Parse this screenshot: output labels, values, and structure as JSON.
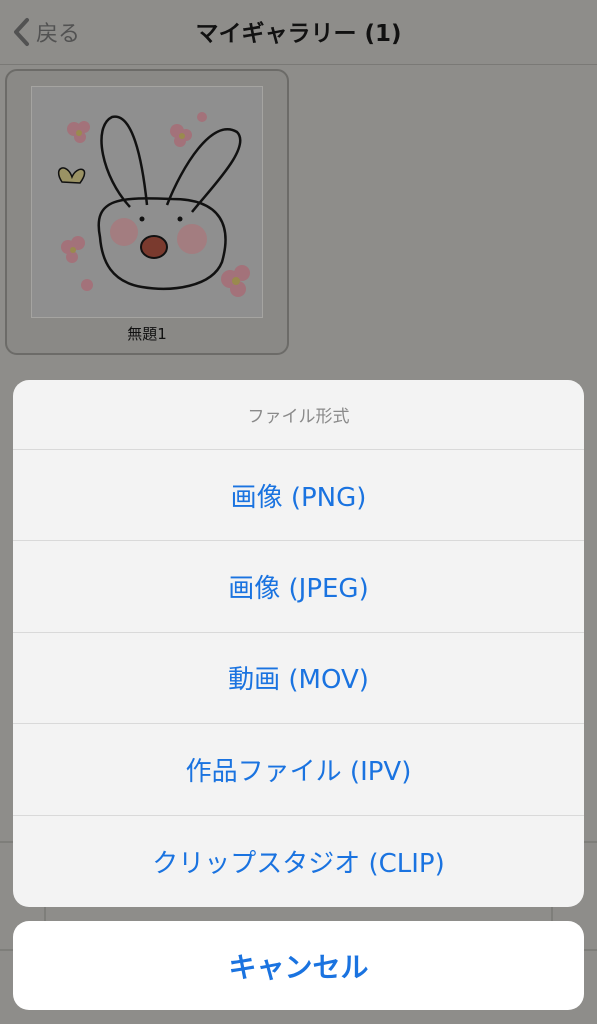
{
  "navbar": {
    "back_label": "戻る",
    "title": "マイギャラリー (1)"
  },
  "gallery": {
    "items": [
      {
        "caption": "無題1"
      }
    ]
  },
  "action_sheet": {
    "title": "ファイル形式",
    "options": [
      {
        "label": "画像 (PNG)"
      },
      {
        "label": "画像 (JPEG)"
      },
      {
        "label": "動画 (MOV)"
      },
      {
        "label": "作品ファイル (IPV)"
      },
      {
        "label": "クリップスタジオ (CLIP)"
      }
    ],
    "cancel_label": "キャンセル"
  },
  "colors": {
    "accent": "#1a73e0",
    "dim_background": "#8e8d8a",
    "sheet_background": "#f3f3f3"
  }
}
